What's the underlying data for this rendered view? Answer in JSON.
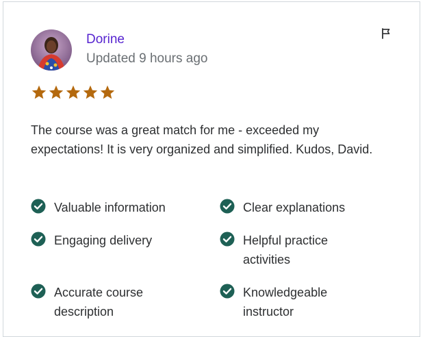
{
  "review": {
    "reviewer_name": "Dorine",
    "updated": "Updated 9 hours ago",
    "rating": 5,
    "text": "The course was a great match for me - exceeded my expectations! It is very organized and simplified. Kudos, David."
  },
  "features": [
    {
      "label": "Valuable information"
    },
    {
      "label": "Clear explanations"
    },
    {
      "label": "Engaging delivery"
    },
    {
      "label": "Helpful practice activities"
    },
    {
      "label": "Accurate course description"
    },
    {
      "label": "Knowledgeable instructor"
    }
  ],
  "icons": {
    "report": "flag-icon",
    "rating": "star-icon",
    "feature": "check-circle-icon"
  },
  "colors": {
    "name": "#5624d0",
    "star": "#b4690e",
    "check": "#1e6055",
    "muted": "#6a6f73",
    "text": "#2d2f31"
  }
}
